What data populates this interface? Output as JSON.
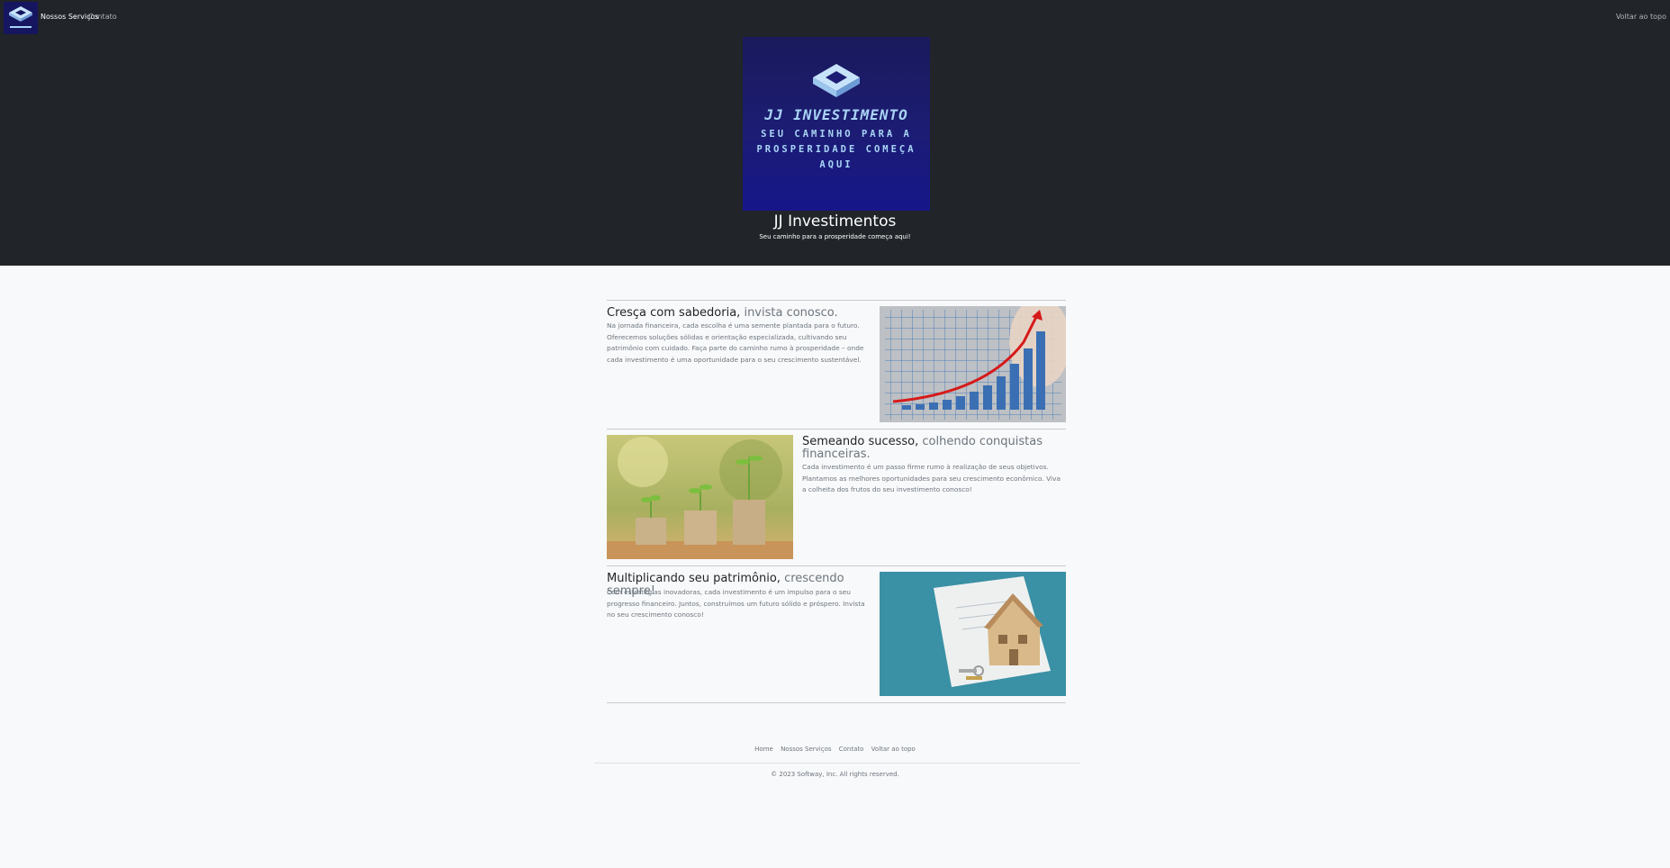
{
  "nav": {
    "services": "Nossos Serviços",
    "contact": "Contato",
    "back_to_top": "Voltar ao topo"
  },
  "hero": {
    "logo_brand": "JJ INVESTIMENTO",
    "logo_tagline": "SEU CAMINHO PARA A PROSPERIDADE COMEÇA AQUI",
    "title": "JJ Investimentos",
    "subtitle": "Seu caminho para a prosperidade começa aqui!"
  },
  "features": [
    {
      "title_main": "Cresça com sabedoria,",
      "title_muted": "invista conosco.",
      "text": "Na jornada financeira, cada escolha é uma semente plantada para o futuro. Oferecemos soluções sólidas e orientação especializada, cultivando seu patrimônio com cuidado. Faça parte do caminho rumo à prosperidade – onde cada investimento é uma oportunidade para o seu crescimento sustentável."
    },
    {
      "title_main": "Semeando sucesso,",
      "title_muted": "colhendo conquistas financeiras.",
      "text": "Cada investimento é um passo firme rumo à realização de seus objetivos. Plantamos as melhores oportunidades para seu crescimento econômico. Viva a colheita dos frutos do seu investimento conosco!"
    },
    {
      "title_main": "Multiplicando seu patrimônio,",
      "title_muted": "crescendo sempre!",
      "text": "Com estratégias inovadoras, cada investimento é um impulso para o seu progresso financeiro. Juntos, construímos um futuro sólido e próspero. Invista no seu crescimento conosco!"
    }
  ],
  "footer": {
    "links": [
      "Home",
      "Nossos Serviços",
      "Contato",
      "Voltar ao topo"
    ],
    "copyright": "© 2023 Softway, Inc. All rights reserved."
  },
  "colors": {
    "header_bg": "#212529",
    "page_bg": "#f8f9fa",
    "logo_bg": "#1c1c74",
    "logo_text": "#a9d4f6"
  }
}
